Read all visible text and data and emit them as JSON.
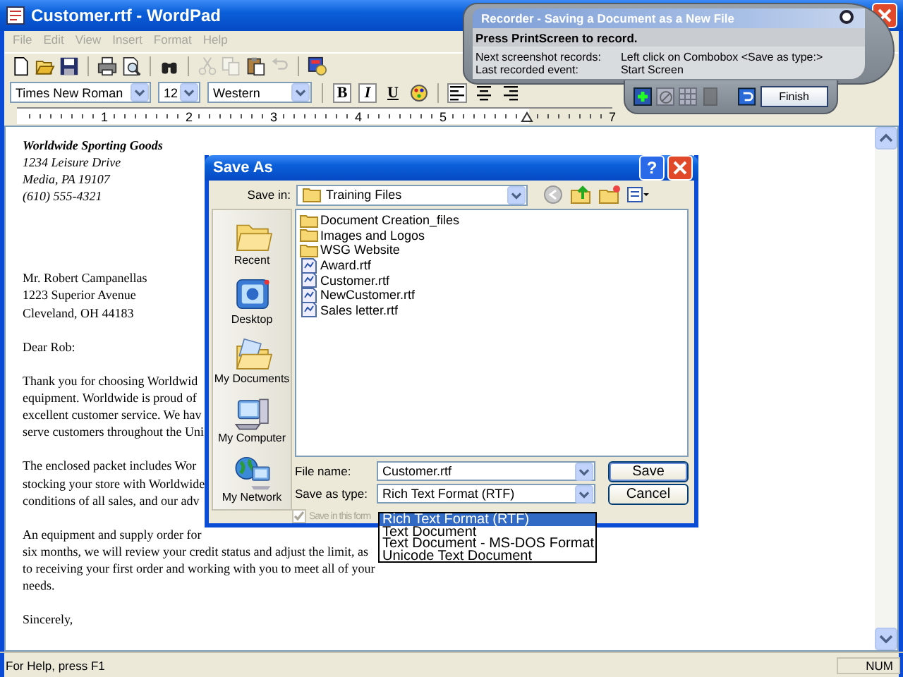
{
  "window": {
    "title": "Customer.rtf - WordPad"
  },
  "menu": [
    {
      "label": "File",
      "disabled": true
    },
    {
      "label": "Edit",
      "disabled": true
    },
    {
      "label": "View",
      "disabled": true
    },
    {
      "label": "Insert",
      "disabled": true
    },
    {
      "label": "Format",
      "disabled": true
    },
    {
      "label": "Help",
      "disabled": true
    }
  ],
  "toolbar": [
    {
      "kind": "new",
      "disabled": false
    },
    {
      "kind": "open",
      "disabled": false
    },
    {
      "kind": "save",
      "disabled": false
    },
    {
      "kind": "sep"
    },
    {
      "kind": "print",
      "disabled": false
    },
    {
      "kind": "preview",
      "disabled": false
    },
    {
      "kind": "sep"
    },
    {
      "kind": "find",
      "disabled": false
    },
    {
      "kind": "sep"
    },
    {
      "kind": "cut",
      "disabled": true
    },
    {
      "kind": "copy",
      "disabled": true
    },
    {
      "kind": "paste",
      "disabled": false
    },
    {
      "kind": "undo",
      "disabled": true
    },
    {
      "kind": "sep"
    },
    {
      "kind": "datetime",
      "disabled": false
    }
  ],
  "format_bar": {
    "font": "Times New Roman",
    "size": "12",
    "script": "Western",
    "styles": [
      {
        "kind": "bold",
        "label": "B",
        "pressed": true
      },
      {
        "kind": "italic",
        "label": "I",
        "pressed": true
      },
      {
        "kind": "underline",
        "label": "U",
        "pressed": false
      }
    ],
    "aligns": [
      {
        "kind": "left",
        "pressed": true
      },
      {
        "kind": "center",
        "pressed": false
      },
      {
        "kind": "right",
        "pressed": false
      }
    ]
  },
  "ruler": [
    {
      "kind": "number",
      "label": "1"
    },
    {
      "kind": "number",
      "label": "2"
    },
    {
      "kind": "number",
      "label": "3"
    },
    {
      "kind": "number",
      "label": "4"
    },
    {
      "kind": "number",
      "label": "5"
    },
    {
      "kind": "marker"
    },
    {
      "kind": "number",
      "label": "7"
    }
  ],
  "document": {
    "paragraphs": [
      {
        "lines": [
          {
            "text": "Worldwide Sporting Goods",
            "kind": "heading"
          },
          {
            "text": "1234 Leisure Drive",
            "kind": "address"
          },
          {
            "text": "Media, PA 19107",
            "kind": "address"
          },
          {
            "text": "(610) 555-4321",
            "kind": "address"
          }
        ]
      },
      {
        "lines": [
          {
            "text": "Mr. Robert Campanellas",
            "kind": "body"
          },
          {
            "text": "1223 Superior Avenue",
            "kind": "body"
          },
          {
            "text": "Cleveland, OH  44183",
            "kind": "body"
          }
        ]
      },
      {
        "lines": [
          {
            "text": "Dear Rob:",
            "kind": "body"
          }
        ]
      },
      {
        "lines": [
          {
            "text": "Thank you for choosing Worldwid",
            "kind": "body"
          },
          {
            "text": "equipment. Worldwide is proud of",
            "kind": "body"
          },
          {
            "text": "excellent customer service. We hav",
            "kind": "body"
          },
          {
            "text": "serve customers throughout the Uni",
            "kind": "body"
          }
        ]
      },
      {
        "lines": [
          {
            "text": "The enclosed packet includes Wor",
            "kind": "body"
          },
          {
            "text": "stocking your store with Worldwide",
            "kind": "body"
          },
          {
            "text": "conditions of all sales, and our adv",
            "kind": "body"
          }
        ]
      },
      {
        "lines": [
          {
            "text": "An equipment and supply order for",
            "kind": "body"
          },
          {
            "text": "six months, we will review your credit status and adjust the limit, as",
            "kind": "body"
          },
          {
            "text": "to receiving your first order and working with you to meet all of your",
            "kind": "body"
          },
          {
            "text": "needs.",
            "kind": "body"
          }
        ]
      },
      {
        "lines": [
          {
            "text": "Sincerely,",
            "kind": "body"
          }
        ]
      }
    ]
  },
  "status_bar": {
    "help": "For Help, press F1",
    "num": "NUM"
  },
  "recorder": {
    "title": "Recorder - Saving a Document as a New File",
    "instruction": "Press PrintScreen to record.",
    "next_label": "Next screenshot records:",
    "next_value": "Left click on Combobox <Save as type:>",
    "last_label": "Last recorded event:",
    "last_value": "Start Screen",
    "tools": [
      {
        "kind": "add",
        "disabled": false
      },
      {
        "kind": "delete",
        "disabled": true
      },
      {
        "kind": "grid",
        "disabled": true
      },
      {
        "kind": "stop",
        "disabled": true
      }
    ],
    "finish": "Finish"
  },
  "dialog": {
    "title": "Save As",
    "help": "?",
    "save_in_label": "Save in:",
    "save_in": "Training Files",
    "places": [
      {
        "kind": "recent",
        "label": "Recent"
      },
      {
        "kind": "desktop",
        "label": "Desktop"
      },
      {
        "kind": "documents",
        "label": "My Documents"
      },
      {
        "kind": "computer",
        "label": "My Computer"
      },
      {
        "kind": "network",
        "label": "My Network"
      }
    ],
    "files": [
      {
        "kind": "folder",
        "name": "Document Creation_files"
      },
      {
        "kind": "folder",
        "name": "Images and Logos"
      },
      {
        "kind": "folder",
        "name": "WSG Website"
      },
      {
        "kind": "file",
        "name": "Award.rtf"
      },
      {
        "kind": "file",
        "name": "Customer.rtf"
      },
      {
        "kind": "file",
        "name": "NewCustomer.rtf"
      },
      {
        "kind": "file",
        "name": "Sales letter.rtf"
      }
    ],
    "file_name_label": "File name:",
    "file_name": "Customer.rtf",
    "type_label": "Save as type:",
    "type": "Rich Text Format (RTF)",
    "save": "Save",
    "cancel": "Cancel",
    "checkbox": {
      "label": "Save in this form",
      "checked": true,
      "disabled": true
    },
    "type_options": [
      {
        "label": "Rich Text Format (RTF)",
        "selected": true
      },
      {
        "label": "Text Document",
        "selected": false
      },
      {
        "label": "Text Document - MS-DOS Format",
        "selected": false
      },
      {
        "label": "Unicode Text Document",
        "selected": false
      }
    ]
  }
}
